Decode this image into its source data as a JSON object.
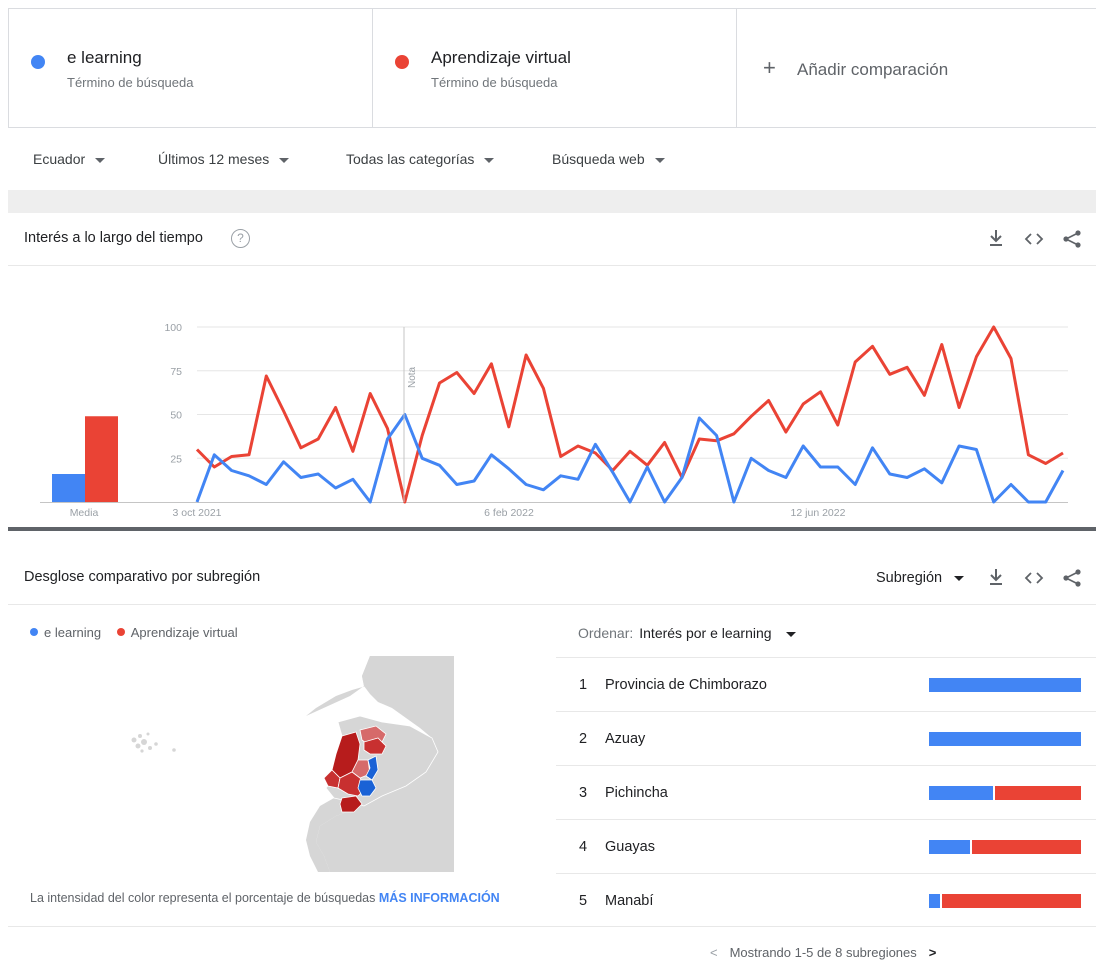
{
  "terms": [
    {
      "name": "e learning",
      "type": "Término de búsqueda",
      "color": "#4285f4"
    },
    {
      "name": "Aprendizaje virtual",
      "type": "Término de búsqueda",
      "color": "#ea4335"
    }
  ],
  "add_comparison": {
    "plus": "+",
    "label": "Añadir comparación"
  },
  "filters": [
    {
      "label": "Ecuador"
    },
    {
      "label": "Últimos 12 meses"
    },
    {
      "label": "Todas las categorías"
    },
    {
      "label": "Búsqueda web"
    }
  ],
  "interest": {
    "title": "Interés a lo largo del tiempo",
    "help": "?",
    "note": "Nota",
    "average_label": "Media"
  },
  "icons": {
    "download": "download-icon",
    "embed": "embed-icon",
    "share": "share-icon",
    "help": "help-icon"
  },
  "chart_data": {
    "type": "line",
    "x_labels": [
      "3 oct 2021",
      "6 feb 2022",
      "12 jun 2022"
    ],
    "yticks": [
      25,
      50,
      75,
      100
    ],
    "ylim": [
      0,
      100
    ],
    "series": [
      {
        "name": "e learning",
        "color": "#4285f4",
        "average": 16,
        "values": [
          0,
          27,
          18,
          15,
          10,
          23,
          14,
          16,
          8,
          13,
          0,
          36,
          50,
          25,
          21,
          10,
          12,
          27,
          19,
          10,
          7,
          15,
          13,
          33,
          17,
          0,
          20,
          0,
          14,
          48,
          38,
          0,
          25,
          18,
          14,
          32,
          20,
          20,
          10,
          31,
          16,
          14,
          19,
          11,
          32,
          30,
          0,
          10,
          0,
          0,
          18
        ]
      },
      {
        "name": "Aprendizaje virtual",
        "color": "#ea4335",
        "average": 49,
        "values": [
          30,
          20,
          26,
          27,
          72,
          52,
          31,
          36,
          54,
          29,
          62,
          42,
          0,
          38,
          68,
          74,
          62,
          79,
          43,
          84,
          65,
          26,
          32,
          28,
          18,
          29,
          21,
          34,
          14,
          36,
          35,
          39,
          49,
          58,
          40,
          56,
          63,
          44,
          80,
          89,
          73,
          77,
          61,
          90,
          54,
          83,
          100,
          82,
          27,
          22,
          28
        ]
      }
    ]
  },
  "subregion": {
    "title": "Desglose comparativo por subregión",
    "dropdown": "Subregión",
    "legend": [
      "e learning",
      "Aprendizaje virtual"
    ],
    "intensity_text": "La intensidad del color representa el porcentaje de búsquedas",
    "more_info": "MÁS INFORMACIÓN",
    "sort_label": "Ordenar:",
    "sort_value": "Interés por e learning",
    "regions": [
      {
        "rank": "1",
        "name": "Provincia de Chimborazo",
        "e_learning_pct": 100,
        "virtual_pct": 0
      },
      {
        "rank": "2",
        "name": "Azuay",
        "e_learning_pct": 100,
        "virtual_pct": 0
      },
      {
        "rank": "3",
        "name": "Pichincha",
        "e_learning_pct": 42,
        "virtual_pct": 58
      },
      {
        "rank": "4",
        "name": "Guayas",
        "e_learning_pct": 27,
        "virtual_pct": 73
      },
      {
        "rank": "5",
        "name": "Manabí",
        "e_learning_pct": 7,
        "virtual_pct": 93
      }
    ],
    "pager_text": "Mostrando 1-5 de 8 subregiones",
    "map_colors": {
      "land": "#d6d6d6",
      "blue": "#1a62d6",
      "red_dark": "#b71c1c",
      "red_mid": "#c83030",
      "red_light": "#d66a6a"
    }
  }
}
